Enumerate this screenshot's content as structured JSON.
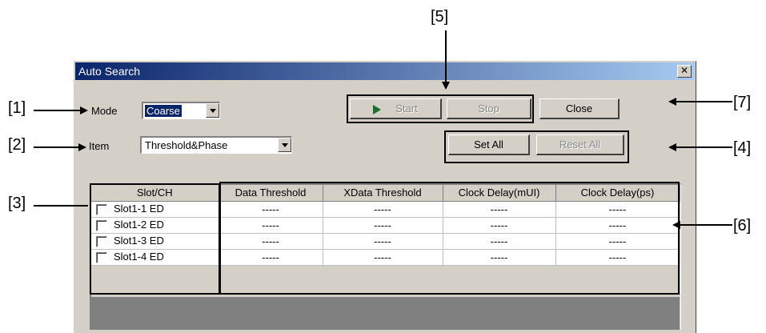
{
  "dialog": {
    "title": "Auto Search",
    "close_glyph": "✕",
    "mode_label": "Mode",
    "mode_value": "Coarse",
    "item_label": "Item",
    "item_value": "Threshold&Phase",
    "buttons": {
      "start": "Start",
      "stop": "Stop",
      "close": "Close",
      "set_all": "Set All",
      "reset_all": "Reset All"
    },
    "table": {
      "headers": [
        "Slot/CH",
        "Data Threshold",
        "XData Threshold",
        "Clock Delay(mUI)",
        "Clock Delay(ps)"
      ],
      "rows": [
        {
          "slot": "Slot1-1 ED",
          "values": [
            "-----",
            "-----",
            "-----",
            "-----"
          ]
        },
        {
          "slot": "Slot1-2 ED",
          "values": [
            "-----",
            "-----",
            "-----",
            "-----"
          ]
        },
        {
          "slot": "Slot1-3 ED",
          "values": [
            "-----",
            "-----",
            "-----",
            "-----"
          ]
        },
        {
          "slot": "Slot1-4 ED",
          "values": [
            "-----",
            "-----",
            "-----",
            "-----"
          ]
        }
      ]
    }
  },
  "callouts": {
    "c1": "[1]",
    "c2": "[2]",
    "c3": "[3]",
    "c4": "[4]",
    "c5": "[5]",
    "c6": "[6]",
    "c7": "[7]"
  }
}
